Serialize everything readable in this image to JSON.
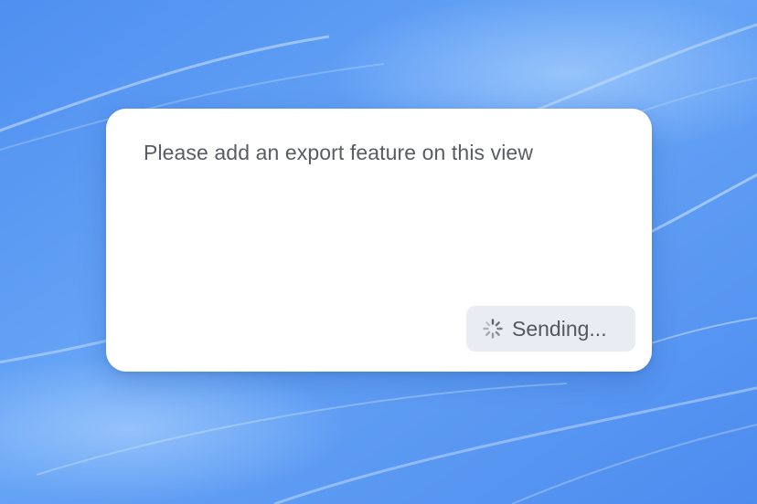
{
  "compose": {
    "message": "Please add an export feature on this view"
  },
  "send_button": {
    "label": "Sending...",
    "icon": "spinner-icon"
  },
  "colors": {
    "background": "#5b97f0",
    "card": "#ffffff",
    "button": "#e9ecf2",
    "text": "#595c63"
  }
}
